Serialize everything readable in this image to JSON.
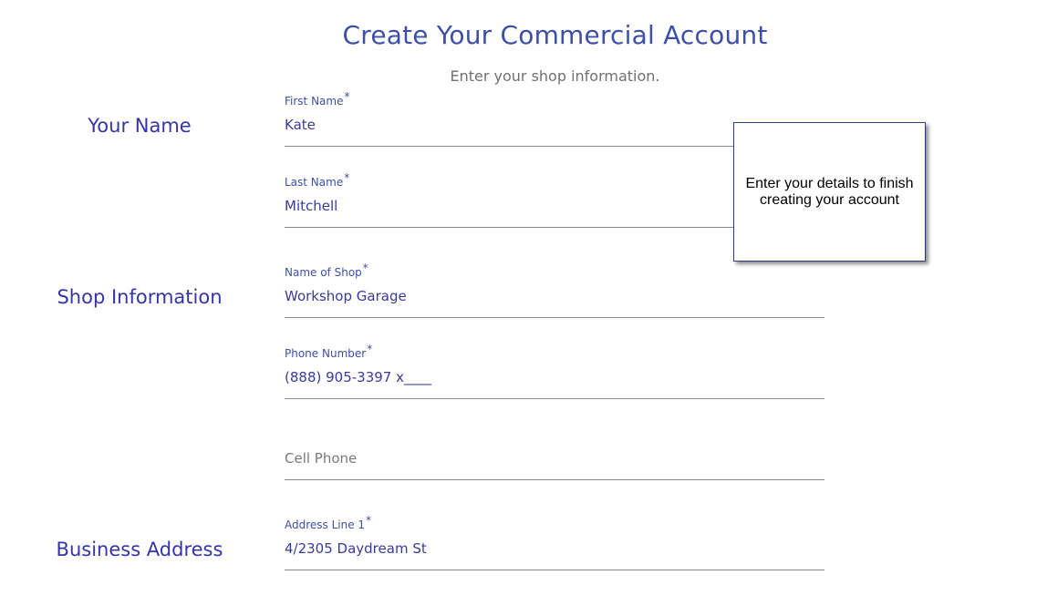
{
  "header": {
    "title": "Create Your Commercial Account",
    "subtitle": "Enter your shop information."
  },
  "sections": {
    "your_name": "Your Name",
    "shop_information": "Shop Information",
    "business_address": "Business Address"
  },
  "fields": {
    "first_name": {
      "label": "First Name",
      "required": "*",
      "value": "Kate"
    },
    "last_name": {
      "label": "Last Name",
      "required": "*",
      "value": "Mitchell"
    },
    "shop_name": {
      "label": "Name of Shop",
      "required": "*",
      "value": "Workshop Garage"
    },
    "phone": {
      "label": "Phone Number",
      "required": "*",
      "value": "(888) 905-3397 x____"
    },
    "cell_phone": {
      "placeholder": "Cell Phone"
    },
    "address_line_1": {
      "label": "Address Line 1",
      "required": "*",
      "value": "4/2305 Daydream St"
    }
  },
  "tooltip": {
    "text": "Enter your details to finish creating your account"
  }
}
